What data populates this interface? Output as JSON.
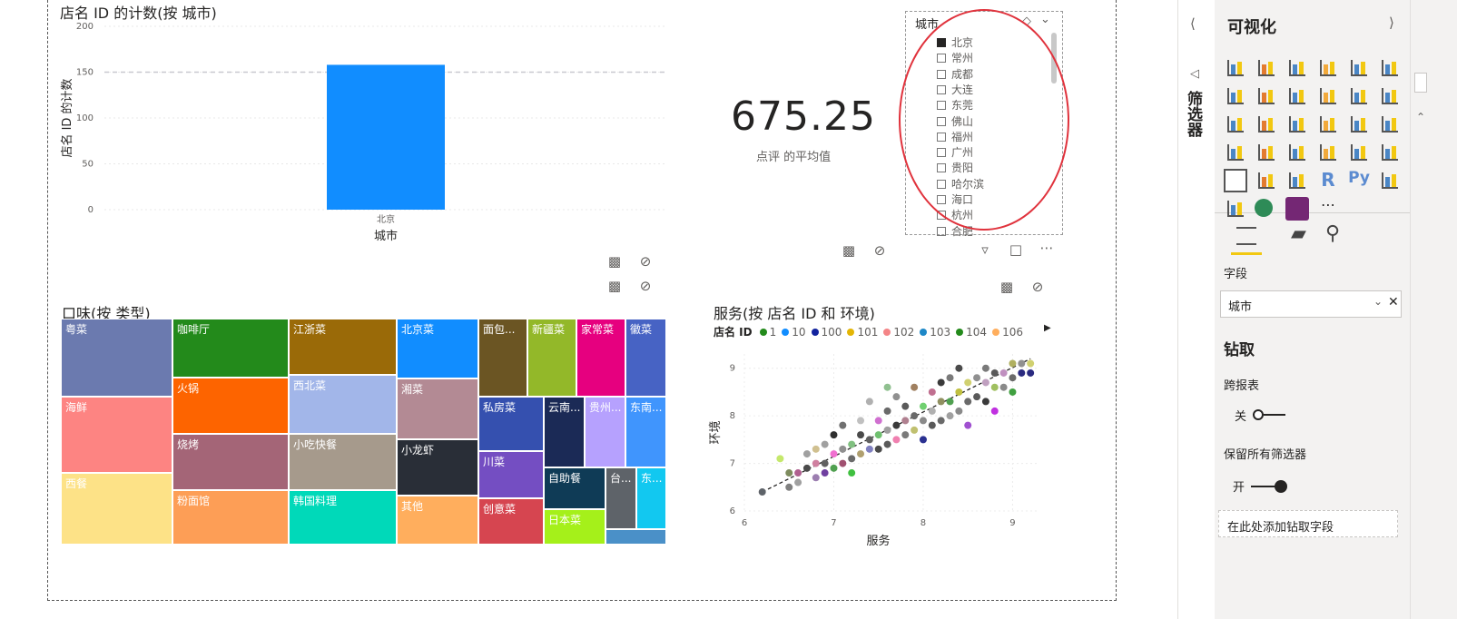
{
  "bar_visual": {
    "title": "店名 ID 的计数(按 城市)",
    "chart_data": {
      "type": "bar",
      "categories": [
        "北京"
      ],
      "values": [
        158
      ],
      "xlabel": "城市",
      "ylabel": "店名 ID 的计数",
      "ylim": [
        0,
        200
      ],
      "yticks": [
        "200",
        "150",
        "100",
        "50",
        "0"
      ],
      "reference_line": 150,
      "color": "#118DFF"
    }
  },
  "card_visual": {
    "value": "675.25",
    "label": "点评 的平均值"
  },
  "slicer": {
    "title": "城市",
    "items": [
      "北京",
      "常州",
      "成都",
      "大连",
      "东莞",
      "佛山",
      "福州",
      "广州",
      "贵阳",
      "哈尔滨",
      "海口",
      "杭州",
      "合肥"
    ],
    "checked": [
      "北京"
    ]
  },
  "treemap_visual": {
    "title": "口味(按 类型)",
    "chart_data": {
      "type": "treemap",
      "items": [
        {
          "name": "粤菜",
          "color": "#6B7AAF"
        },
        {
          "name": "海鲜",
          "color": "#FD8482"
        },
        {
          "name": "西餐",
          "color": "#FDE287"
        },
        {
          "name": "咖啡厅",
          "color": "#238A1B"
        },
        {
          "name": "火锅",
          "color": "#FD6400"
        },
        {
          "name": "烧烤",
          "color": "#A46577"
        },
        {
          "name": "粉面馆",
          "color": "#FD9E56"
        },
        {
          "name": "江浙菜",
          "color": "#9A6A08"
        },
        {
          "name": "西北菜",
          "color": "#A2B6E9"
        },
        {
          "name": "小吃快餐",
          "color": "#A69A8C"
        },
        {
          "name": "韩国料理",
          "color": "#00D9B9"
        },
        {
          "name": "北京菜",
          "color": "#118DFF"
        },
        {
          "name": "湘菜",
          "color": "#B38A94"
        },
        {
          "name": "小龙虾",
          "color": "#292E37"
        },
        {
          "name": "其他",
          "color": "#FFAE5D"
        },
        {
          "name": "面包...",
          "color": "#6B5523"
        },
        {
          "name": "新疆菜",
          "color": "#93B829"
        },
        {
          "name": "家常菜",
          "color": "#E6007F"
        },
        {
          "name": "徽菜",
          "color": "#4763C4"
        },
        {
          "name": "私房菜",
          "color": "#3550AF"
        },
        {
          "name": "云南...",
          "color": "#1B2A56"
        },
        {
          "name": "贵州...",
          "color": "#B6A1FE"
        },
        {
          "name": "东南...",
          "color": "#4095FD"
        },
        {
          "name": "川菜",
          "color": "#744EC2"
        },
        {
          "name": "自助餐",
          "color": "#0F3B56"
        },
        {
          "name": "台...",
          "color": "#5E6369"
        },
        {
          "name": "东...",
          "color": "#12C8F0"
        },
        {
          "name": "创意菜",
          "color": "#D64550"
        },
        {
          "name": "日本菜",
          "color": "#A5F01A"
        },
        {
          "name": "",
          "color": "#4A90C8"
        }
      ]
    }
  },
  "scatter_visual": {
    "title": "服务(按 店名 ID 和 环境)",
    "legend": {
      "label": "店名 ID",
      "entries": [
        {
          "name": "1",
          "color": "#238A1B"
        },
        {
          "name": "10",
          "color": "#118DFF"
        },
        {
          "name": "100",
          "color": "#12239E"
        },
        {
          "name": "101",
          "color": "#E3B505"
        },
        {
          "name": "102",
          "color": "#F48587"
        },
        {
          "name": "103",
          "color": "#1E88C7"
        },
        {
          "name": "104",
          "color": "#238A1B"
        },
        {
          "name": "106",
          "color": "#FFAE5D"
        }
      ]
    },
    "chart_data": {
      "type": "scatter",
      "xlabel": "服务",
      "ylabel": "环境",
      "xlim": [
        6,
        9.3
      ],
      "ylim": [
        6,
        9.3
      ],
      "xticks": [
        "6",
        "7",
        "8",
        "9"
      ],
      "yticks": [
        "9",
        "8",
        "7",
        "6"
      ],
      "points": [
        [
          6.2,
          6.4
        ],
        [
          6.4,
          7.1
        ],
        [
          6.5,
          6.5
        ],
        [
          6.5,
          6.8
        ],
        [
          6.6,
          6.6
        ],
        [
          6.6,
          6.8
        ],
        [
          6.7,
          6.9
        ],
        [
          6.8,
          6.7
        ],
        [
          6.8,
          7.0
        ],
        [
          6.8,
          7.3
        ],
        [
          6.9,
          6.8
        ],
        [
          6.9,
          7.0
        ],
        [
          6.9,
          7.4
        ],
        [
          7.0,
          6.9
        ],
        [
          7.0,
          7.2
        ],
        [
          7.0,
          7.6
        ],
        [
          7.1,
          7.0
        ],
        [
          7.1,
          7.3
        ],
        [
          7.2,
          6.8
        ],
        [
          7.2,
          7.1
        ],
        [
          7.2,
          7.4
        ],
        [
          7.3,
          7.2
        ],
        [
          7.3,
          7.6
        ],
        [
          7.3,
          7.9
        ],
        [
          7.4,
          7.3
        ],
        [
          7.4,
          7.5
        ],
        [
          7.4,
          8.3
        ],
        [
          7.5,
          7.3
        ],
        [
          7.5,
          7.6
        ],
        [
          7.5,
          7.9
        ],
        [
          7.6,
          7.4
        ],
        [
          7.6,
          7.7
        ],
        [
          7.6,
          8.1
        ],
        [
          7.7,
          7.5
        ],
        [
          7.7,
          7.8
        ],
        [
          7.7,
          8.4
        ],
        [
          7.8,
          7.6
        ],
        [
          7.8,
          7.9
        ],
        [
          7.8,
          8.2
        ],
        [
          7.9,
          7.7
        ],
        [
          7.9,
          8.0
        ],
        [
          7.9,
          8.6
        ],
        [
          8.0,
          7.5
        ],
        [
          8.0,
          7.9
        ],
        [
          8.0,
          8.2
        ],
        [
          8.1,
          7.8
        ],
        [
          8.1,
          8.1
        ],
        [
          8.1,
          8.5
        ],
        [
          8.2,
          7.9
        ],
        [
          8.2,
          8.3
        ],
        [
          8.2,
          8.7
        ],
        [
          8.3,
          8.0
        ],
        [
          8.3,
          8.3
        ],
        [
          8.3,
          8.8
        ],
        [
          8.4,
          8.1
        ],
        [
          8.4,
          8.5
        ],
        [
          8.4,
          9.0
        ],
        [
          8.5,
          7.8
        ],
        [
          8.5,
          8.3
        ],
        [
          8.5,
          8.7
        ],
        [
          8.6,
          8.4
        ],
        [
          8.6,
          8.8
        ],
        [
          8.7,
          8.3
        ],
        [
          8.7,
          8.7
        ],
        [
          8.7,
          9.0
        ],
        [
          8.8,
          8.6
        ],
        [
          8.8,
          8.9
        ],
        [
          8.9,
          8.6
        ],
        [
          8.9,
          8.9
        ],
        [
          9.0,
          8.5
        ],
        [
          9.0,
          8.8
        ],
        [
          9.0,
          9.1
        ],
        [
          9.1,
          8.9
        ],
        [
          9.1,
          9.1
        ],
        [
          9.2,
          8.9
        ],
        [
          9.2,
          9.1
        ],
        [
          8.8,
          8.1
        ],
        [
          6.7,
          7.2
        ],
        [
          7.1,
          7.8
        ],
        [
          7.6,
          8.6
        ]
      ],
      "point_colors": [
        "#5E6369",
        "#C5E86C",
        "#808080",
        "#7E8C5E",
        "#A0A0A0",
        "#B06090",
        "#4A4A4A",
        "#9C7EB0",
        "#D080A0",
        "#D0C090",
        "#7040A0",
        "#606060",
        "#A0A0A0",
        "#50A050",
        "#F070D0",
        "#303030",
        "#A05070",
        "#909090",
        "#40C040",
        "#6A6A6A",
        "#80C080",
        "#B0A070",
        "#4A4A4A",
        "#C0C0C0",
        "#8080C0",
        "#606060",
        "#B0B0B0",
        "#4A4A4A",
        "#70C070",
        "#D070D0",
        "#5A5A5A",
        "#A0A0A0",
        "#6A6A6A",
        "#F080B0",
        "#3A3A3A",
        "#909090",
        "#7A7A7A",
        "#B08090",
        "#5A5A5A",
        "#C0C070",
        "#6A6A6A",
        "#A08060",
        "#2A3090",
        "#8A8A8A",
        "#70D070",
        "#5A5A5A",
        "#B0B0B0",
        "#C07090",
        "#6A6A6A",
        "#909060",
        "#3A3A3A",
        "#A0A0A0",
        "#50A050",
        "#7A7A7A",
        "#8A8A8A",
        "#C0C040",
        "#4A4A4A",
        "#A050D0",
        "#6A6A6A",
        "#D0D070",
        "#5A5A5A",
        "#909090",
        "#3A3A3A",
        "#C0A0C0",
        "#7A7A7A",
        "#A0C060",
        "#5A5A5A",
        "#8A8A8A",
        "#C090C0",
        "#40A040",
        "#6A6A6A",
        "#B0B060",
        "#2A2A80",
        "#909090",
        "#2A2A80",
        "#D0D070",
        "#C030E0",
        "#A0A0A0",
        "#707070",
        "#90C090"
      ]
    }
  },
  "right_pane": {
    "filters_label": "筛选器",
    "viz_title": "可视化",
    "tab_fields_label": "字段",
    "field_value": "城市",
    "drill_title": "钻取",
    "cross_report_label": "跨报表",
    "cross_report_state": "关",
    "keep_filters_label": "保留所有筛选器",
    "keep_filters_state": "开",
    "add_drill_placeholder": "在此处添加钻取字段",
    "more_label": "..."
  }
}
